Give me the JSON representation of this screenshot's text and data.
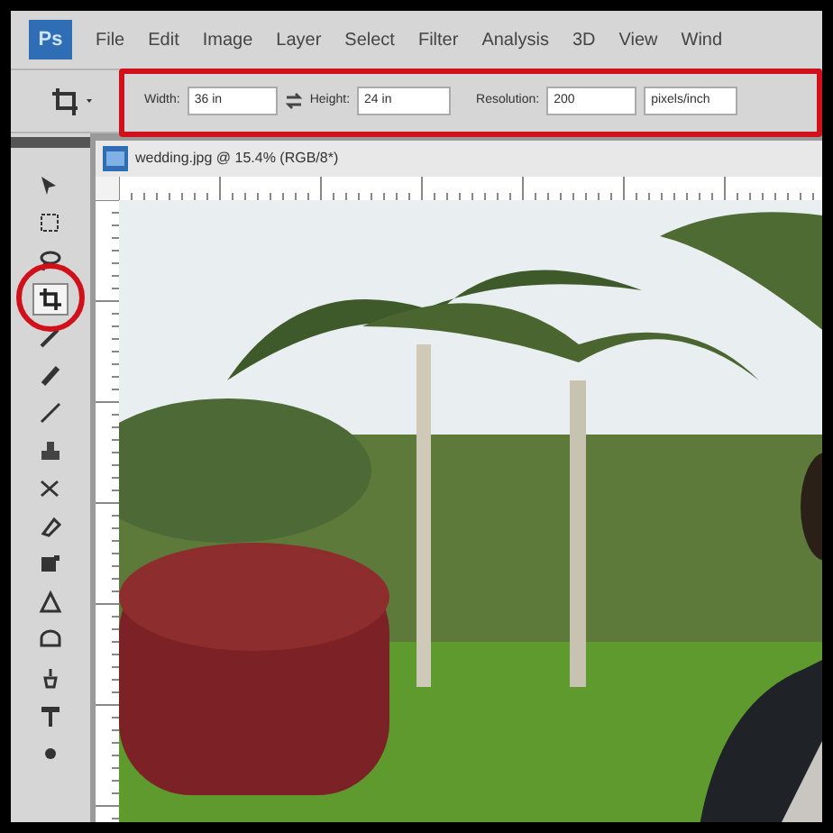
{
  "app_logo": "Ps",
  "menu": [
    "File",
    "Edit",
    "Image",
    "Layer",
    "Select",
    "Filter",
    "Analysis",
    "3D",
    "View",
    "Wind"
  ],
  "options_bar": {
    "width_label": "Width:",
    "width_value": "36 in",
    "height_label": "Height:",
    "height_value": "24 in",
    "resolution_label": "Resolution:",
    "resolution_value": "200",
    "unit": "pixels/inch"
  },
  "tools": [
    {
      "selected": false
    },
    {
      "selected": false
    },
    {
      "selected": false
    },
    {
      "selected": true
    },
    {
      "selected": false
    },
    {
      "selected": false
    },
    {
      "selected": false
    },
    {
      "selected": false
    },
    {
      "selected": false
    },
    {
      "selected": false
    },
    {
      "selected": false
    },
    {
      "selected": false
    },
    {
      "selected": false
    },
    {
      "selected": false
    },
    {
      "selected": false
    },
    {
      "selected": false
    }
  ],
  "document": {
    "title": "wedding.jpg @ 15.4% (RGB/8*)"
  }
}
